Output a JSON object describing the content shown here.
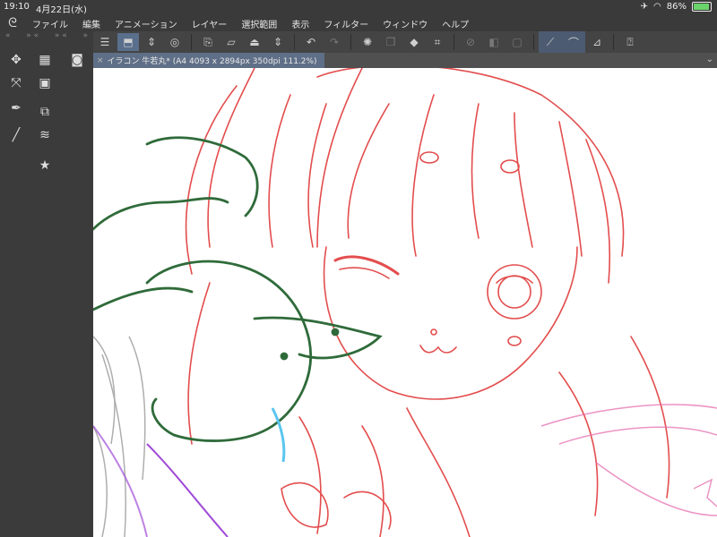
{
  "status": {
    "time": "19:10",
    "date": "4月22日(水)",
    "battery": "86%",
    "battery_level": 0.86
  },
  "menu": [
    "ファイル",
    "編集",
    "アニメーション",
    "レイヤー",
    "選択範囲",
    "表示",
    "フィルター",
    "ウィンドウ",
    "ヘルプ"
  ],
  "document_tab": {
    "title": "イラコン 牛若丸* (A4 4093 x 2894px 350dpi 111.2%)"
  },
  "colors": {
    "sketch_red": "#e03a3a",
    "sketch_green": "#2f6b3a",
    "sketch_purple": "#a04bd6",
    "sketch_blue": "#5ac6f0",
    "sketch_gray": "#9a9a9a"
  }
}
